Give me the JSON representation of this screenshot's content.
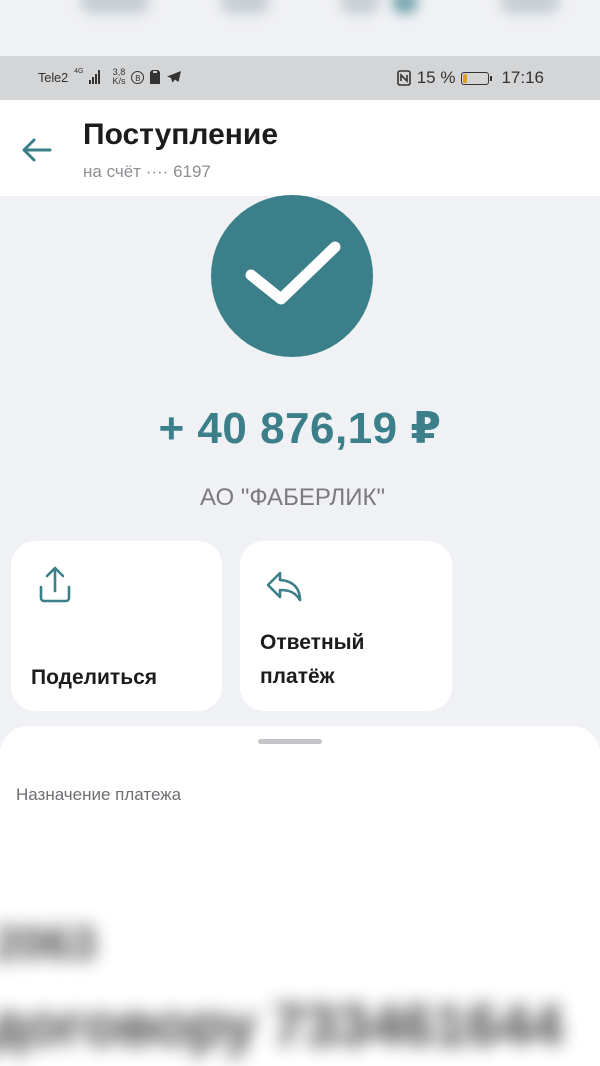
{
  "status_bar": {
    "carrier": "Tele2",
    "network": "4G",
    "speed_value": "3,8",
    "speed_unit": "K/s",
    "vpn_letter": "B",
    "battery_percent": "15 %",
    "time": "17:16"
  },
  "header": {
    "title": "Поступление",
    "subtitle": "на счёт ···· 6197"
  },
  "transaction": {
    "amount": "+ 40 876,19 ₽",
    "payer": "АО \"ФАБЕРЛИК\""
  },
  "actions": {
    "share_label": "Поделиться",
    "reply_line1": "Ответный",
    "reply_line2": "платёж"
  },
  "details": {
    "purpose_label": "Назначение платежа",
    "purpose_line1": "2063",
    "purpose_line2": "договору 733461644"
  },
  "colors": {
    "accent": "#3a7f89",
    "background": "#f0f1f5",
    "battery_low": "#e0a21a"
  }
}
